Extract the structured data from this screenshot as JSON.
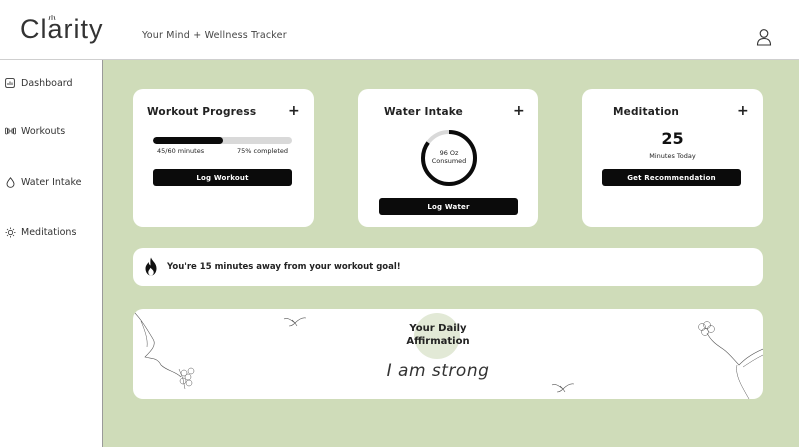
{
  "header": {
    "logo": "Clarity",
    "tagline": "Your Mind + Wellness Tracker",
    "profile_icon": "user-icon"
  },
  "sidebar": {
    "items": [
      {
        "label": "Dashboard",
        "icon": "dashboard-icon"
      },
      {
        "label": "Workouts",
        "icon": "dumbbell-icon"
      },
      {
        "label": "Water Intake",
        "icon": "water-drop-icon"
      },
      {
        "label": "Meditations",
        "icon": "sun-icon"
      }
    ]
  },
  "workout": {
    "title": "Workout Progress",
    "add": "+",
    "progress_fraction": 0.5,
    "minutes_text": "45/60 minutes",
    "percent_text": "75% completed",
    "button": "Log Workout"
  },
  "water": {
    "title": "Water Intake",
    "add": "+",
    "ring_fraction": 0.85,
    "amount": "96 Oz",
    "amount_label": "Consumed",
    "button": "Log Water"
  },
  "meditation": {
    "title": "Meditation",
    "add": "+",
    "minutes": "25",
    "minutes_label": "Minutes Today",
    "button": "Get Recommendation"
  },
  "goal": {
    "icon": "flame-icon",
    "message": "You're 15 minutes away from your workout goal!"
  },
  "affirmation": {
    "title_line1": "Your Daily",
    "title_line2": "Affirmation",
    "quote": "I am strong"
  },
  "colors": {
    "main_bg": "#cfdcb9",
    "card_bg": "#ffffff",
    "button_bg": "#0b0b0b",
    "accent_circle": "#e2e9d6"
  }
}
